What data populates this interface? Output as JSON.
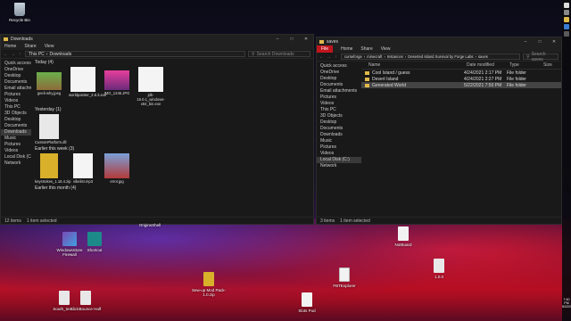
{
  "desktop": {
    "recycle_bin": "Recycle Bin",
    "originslabel": "OriginsShell",
    "icons": [
      {
        "label": "WindowsStore Firewall",
        "kind": "winrar"
      },
      {
        "label": "Shortcut",
        "kind": "shortcut"
      },
      {
        "label": "Sew-up Mod Pack-1.0.zip",
        "kind": "zipico"
      },
      {
        "label": "NotBoard",
        "kind": "docico"
      },
      {
        "label": "1.0.0",
        "kind": "gearico"
      },
      {
        "label": "FBTExplorer",
        "kind": "txtico"
      },
      {
        "label": "South_test...",
        "kind": "gearico"
      },
      {
        "label": "ClickBounce Half",
        "kind": "gearico"
      },
      {
        "label": "Slots Pod",
        "kind": "docico"
      }
    ]
  },
  "downloads_window": {
    "title": "Downloads",
    "ribbon": [
      "Home",
      "Share",
      "View"
    ],
    "path": [
      "This PC",
      "Downloads"
    ],
    "search_placeholder": "Search Downloads",
    "nav": [
      "Quick access",
      "OneDrive",
      "Desktop",
      "Documents",
      "Email attachments",
      "Pictures",
      "Videos",
      "This PC",
      "3D Objects",
      "Desktop",
      "Documents",
      "Downloads",
      "Music",
      "Pictures",
      "Videos",
      "Local Disk (C:)",
      "Network"
    ],
    "groups": [
      {
        "title": "Today (4)",
        "items": [
          "geeli-why.jpeg",
          "worldpainter_2.8.3.exe",
          "IMG_1245.JPG",
          "jdk-16.0.1_windows-x64_bin.exe"
        ]
      },
      {
        "title": "Yesterday (1)",
        "items": [
          "CustomPlatform.dll"
        ]
      },
      {
        "title": "Earlier this week (3)",
        "items": [
          "keystrokes_1.16.4.zip",
          "vibelist.mp3",
          "error.jpg"
        ]
      },
      {
        "title": "Earlier this month (4)",
        "items": []
      }
    ],
    "status": [
      "12 items",
      "1 item selected"
    ]
  },
  "saves_window": {
    "title": "saves",
    "ribbon_file": "File",
    "ribbon": [
      "Home",
      "Share",
      "View"
    ],
    "path": [
      "curseforge",
      "minecraft",
      "Instances",
      "Deserted Island Survival by Forge Labs",
      "saves"
    ],
    "search_placeholder": "Search saves",
    "nav": [
      "Quick access",
      "OneDrive",
      "Desktop",
      "Documents",
      "Email attachments",
      "Pictures",
      "Videos",
      "This PC",
      "3D Objects",
      "Desktop",
      "Documents",
      "Downloads",
      "Music",
      "Pictures",
      "Videos",
      "Local Disk (C:)",
      "Network"
    ],
    "columns": [
      "Name",
      "Date modified",
      "Type",
      "Size"
    ],
    "rows": [
      {
        "name": "Cool Island / guess",
        "date": "4/24/2021 2:17 PM",
        "type": "File folder"
      },
      {
        "name": "Desert Island",
        "date": "4/24/2021 2:27 PM",
        "type": "File folder"
      },
      {
        "name": "Generated World",
        "date": "5/22/2021 7:50 PM",
        "type": "File folder"
      }
    ],
    "status": [
      "3 items",
      "1 item selected"
    ]
  },
  "taskbar": {
    "time": "7:40 PM",
    "date": "5/22/2021"
  }
}
